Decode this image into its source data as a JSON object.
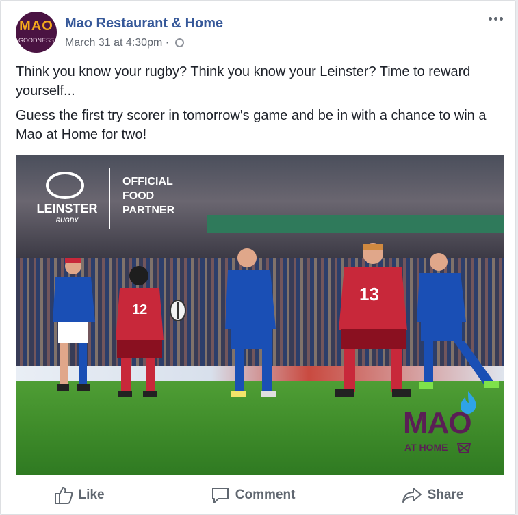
{
  "post": {
    "page_name": "Mao Restaurant & Home",
    "timestamp": "March 31 at 4:30pm",
    "separator": "·",
    "privacy_icon": "globe-icon",
    "avatar": {
      "line1": "MAO",
      "line2": "GOODNESS"
    },
    "paragraphs": [
      "Think you know your rugby? Think you know your Leinster? Time to reward yourself...",
      "Guess the first try scorer in tomorrow's game and be in with a chance to win a Mao at Home for two!"
    ]
  },
  "image": {
    "leinster_word": "LEINSTER",
    "rugby_word": "RUGBY",
    "partner_text": "OFFICIAL\nFOOD\nPARTNER",
    "jersey_12": "12",
    "jersey_13": "13",
    "mao_word": "MAO",
    "mao_home": "AT HOME"
  },
  "actions": {
    "like": "Like",
    "comment": "Comment",
    "share": "Share"
  },
  "colors": {
    "link_blue": "#365899",
    "leinster_blue": "#1a4fb5",
    "munster_red": "#c8283a",
    "mao_purple": "#5a1f55"
  }
}
